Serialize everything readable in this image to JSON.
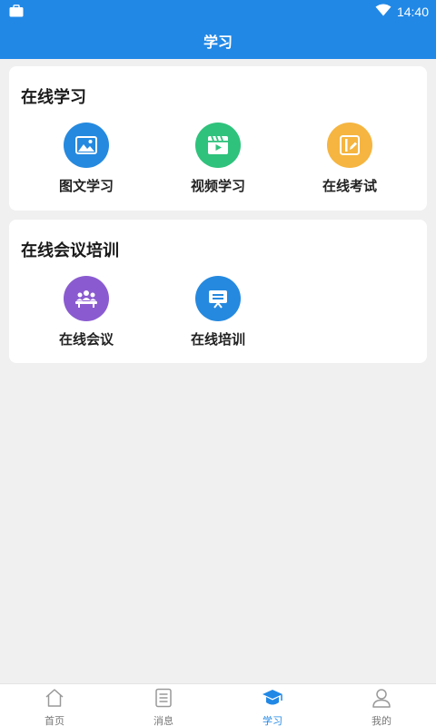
{
  "status_bar": {
    "time": "14:40"
  },
  "header": {
    "title": "学习"
  },
  "sections": [
    {
      "title": "在线学习",
      "items": [
        {
          "label": "图文学习",
          "icon": "image-icon",
          "color": "#2589df"
        },
        {
          "label": "视频学习",
          "icon": "video-icon",
          "color": "#2fc27c"
        },
        {
          "label": "在线考试",
          "icon": "exam-icon",
          "color": "#f5b540"
        }
      ]
    },
    {
      "title": "在线会议培训",
      "items": [
        {
          "label": "在线会议",
          "icon": "meeting-icon",
          "color": "#8a5bd0"
        },
        {
          "label": "在线培训",
          "icon": "training-icon",
          "color": "#2589df"
        }
      ]
    }
  ],
  "tabbar": {
    "active_color": "#2188e6",
    "tabs": [
      {
        "label": "首页",
        "icon": "home-icon"
      },
      {
        "label": "消息",
        "icon": "message-icon"
      },
      {
        "label": "学习",
        "icon": "graduation-cap-icon",
        "active": true
      },
      {
        "label": "我的",
        "icon": "user-icon"
      }
    ]
  }
}
